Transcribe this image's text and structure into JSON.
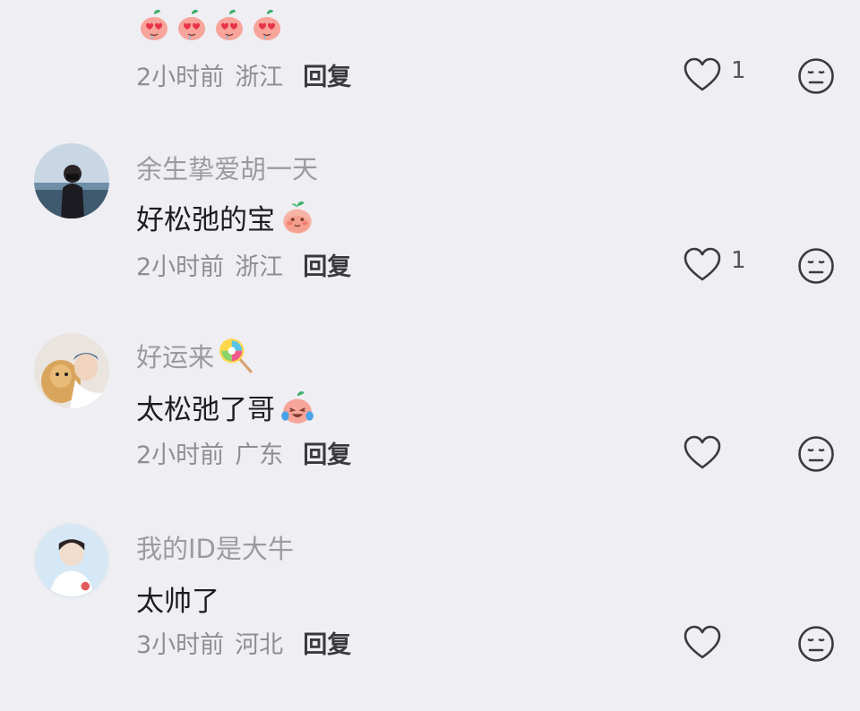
{
  "comments": [
    {
      "username": "",
      "text": "",
      "time": "2小时前",
      "location": "浙江",
      "reply_label": "回复",
      "like_count": "1"
    },
    {
      "username": "余生挚爱胡一天",
      "text": "好松弛的宝",
      "time": "2小时前",
      "location": "浙江",
      "reply_label": "回复",
      "like_count": "1"
    },
    {
      "username": "好运来",
      "text": "太松弛了哥",
      "time": "2小时前",
      "location": "广东",
      "reply_label": "回复",
      "like_count": ""
    },
    {
      "username": "我的ID是大牛",
      "text": "太帅了",
      "time": "3小时前",
      "location": "河北",
      "reply_label": "回复",
      "like_count": ""
    }
  ],
  "icons": {
    "like": "heart-outline-icon",
    "more": "neutral-face-icon",
    "peach_emoji": "peach-face-emoji",
    "lollipop_emoji": "lollipop-emoji"
  },
  "colors": {
    "background": "#efeef3",
    "secondary_text": "#8e8e94",
    "primary_text": "#1d1d1f"
  }
}
